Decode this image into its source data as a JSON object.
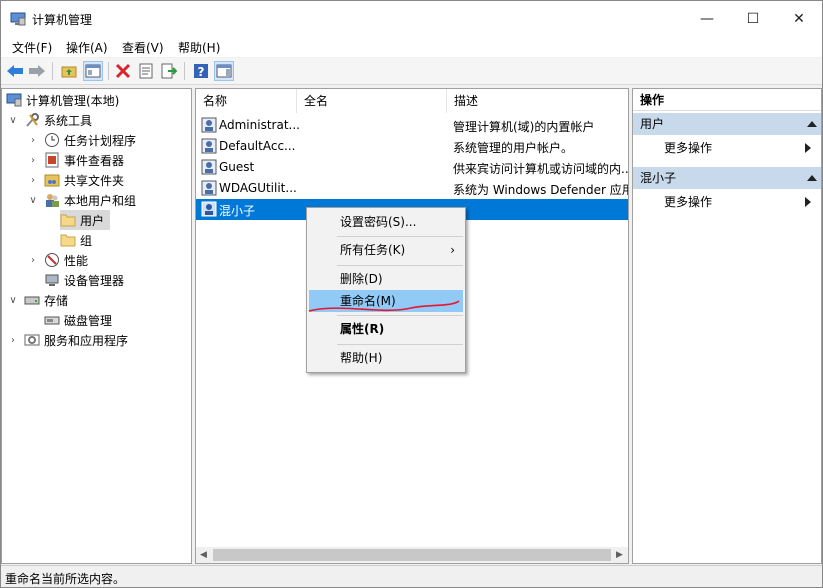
{
  "window": {
    "title": "计算机管理",
    "minimize": "—",
    "maximize": "☐",
    "close": "✕"
  },
  "menu": [
    "文件(F)",
    "操作(A)",
    "查看(V)",
    "帮助(H)"
  ],
  "tree": [
    {
      "label": "计算机管理(本地)",
      "chev": ""
    },
    {
      "label": "系统工具",
      "chev": "∨"
    },
    {
      "label": "任务计划程序",
      "chev": "›"
    },
    {
      "label": "事件查看器",
      "chev": "›"
    },
    {
      "label": "共享文件夹",
      "chev": "›"
    },
    {
      "label": "本地用户和组",
      "chev": "∨"
    },
    {
      "label": "用户",
      "chev": ""
    },
    {
      "label": "组",
      "chev": ""
    },
    {
      "label": "性能",
      "chev": "›"
    },
    {
      "label": "设备管理器",
      "chev": ""
    },
    {
      "label": "存储",
      "chev": "∨"
    },
    {
      "label": "磁盘管理",
      "chev": ""
    },
    {
      "label": "服务和应用程序",
      "chev": "›"
    }
  ],
  "list": {
    "columns": [
      "名称",
      "全名",
      "描述"
    ],
    "rows": [
      {
        "name": "Administrat...",
        "fullname": "",
        "desc": "管理计算机(域)的内置帐户"
      },
      {
        "name": "DefaultAcc...",
        "fullname": "",
        "desc": "系统管理的用户帐户。"
      },
      {
        "name": "Guest",
        "fullname": "",
        "desc": "供来宾访问计算机或访问域的内..."
      },
      {
        "name": "WDAGUtilit...",
        "fullname": "",
        "desc": "系统为 Windows Defender 应用"
      },
      {
        "name": "混小子",
        "fullname": "",
        "desc": ""
      }
    ]
  },
  "actions": {
    "title": "操作",
    "sections": [
      {
        "header": "用户",
        "item": "更多操作"
      },
      {
        "header": "混小子",
        "item": "更多操作"
      }
    ]
  },
  "context_menu": [
    {
      "label": "设置密码(S)...",
      "arrow": ""
    },
    {
      "label": "所有任务(K)",
      "arrow": "›"
    },
    {
      "label": "删除(D)",
      "arrow": ""
    },
    {
      "label": "重命名(M)",
      "arrow": ""
    },
    {
      "label": "属性(R)",
      "arrow": ""
    },
    {
      "label": "帮助(H)",
      "arrow": ""
    }
  ],
  "status": "重命名当前所选内容。",
  "colors": {
    "selection": "#0078d7",
    "menu_highlight": "#91c9f7",
    "annotation": "#e8162a"
  }
}
